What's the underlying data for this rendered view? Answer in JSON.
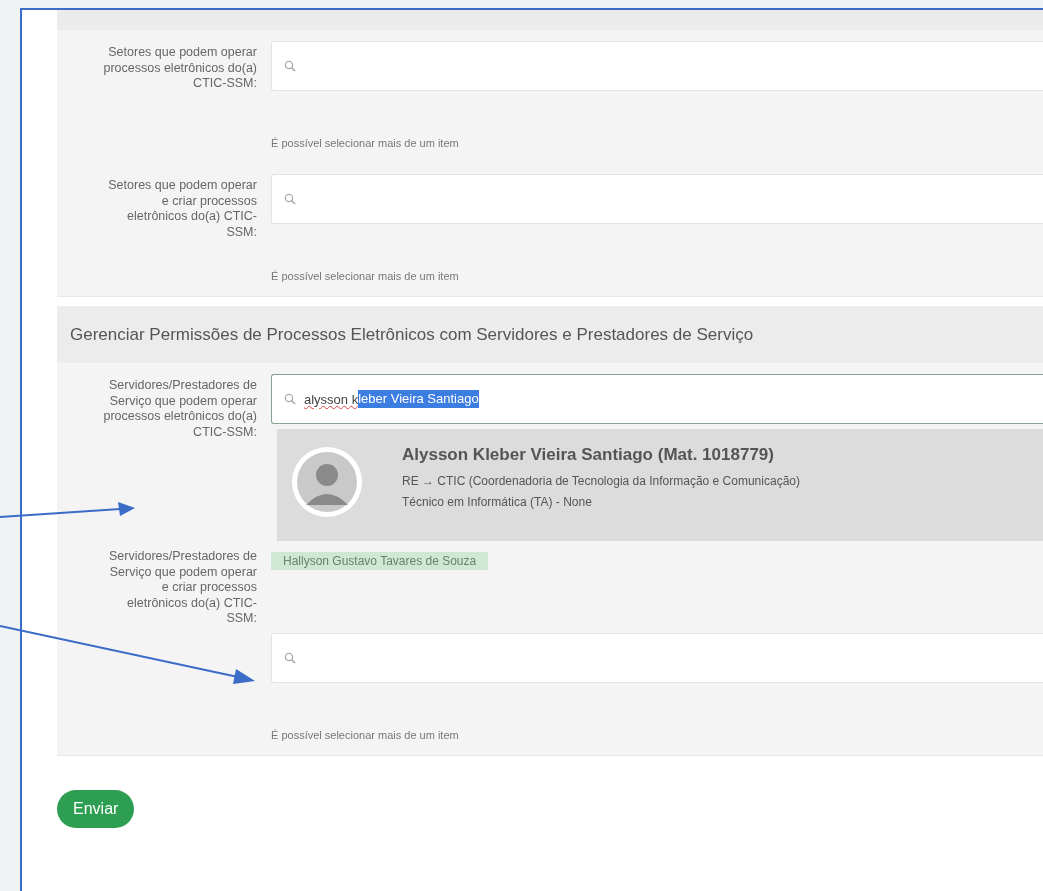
{
  "top_section": {
    "rows": [
      {
        "label": "Setores que podem operar processos eletrônicos do(a) CTIC-SSM:",
        "hint": "É possível selecionar mais de um item"
      },
      {
        "label": "Setores que podem operar e criar processos eletrônicos do(a) CTIC-SSM:",
        "hint": "É possível selecionar mais de um item"
      }
    ]
  },
  "people_section": {
    "title": "Gerenciar Permissões de Processos Eletrônicos com Servidores e Prestadores de Serviço",
    "rows": [
      {
        "kind": "search",
        "label": "Servidores/Prestadores de Serviço que podem operar processos eletrônicos do(a) CTIC-SSM:",
        "value": {
          "typed": "alysson k",
          "highlighted": "leber Vieira Santiago"
        },
        "suggestion": {
          "name": "Alysson Kleber Vieira Santiago (Mat. 1018779)",
          "unit": "RE → CTIC (Coordenadoria de Tecnologia da Informação e Comunicação)",
          "role": "Técnico em Informática (TA) - None"
        }
      },
      {
        "kind": "tags",
        "label": "Servidores/Prestadores de Serviço que podem operar e criar processos eletrônicos do(a) CTIC-SSM:",
        "tags": [
          "Hallyson Gustavo Tavares de Souza"
        ],
        "hint": "É possível selecionar mais de um item"
      }
    ]
  },
  "submit": "Enviar"
}
